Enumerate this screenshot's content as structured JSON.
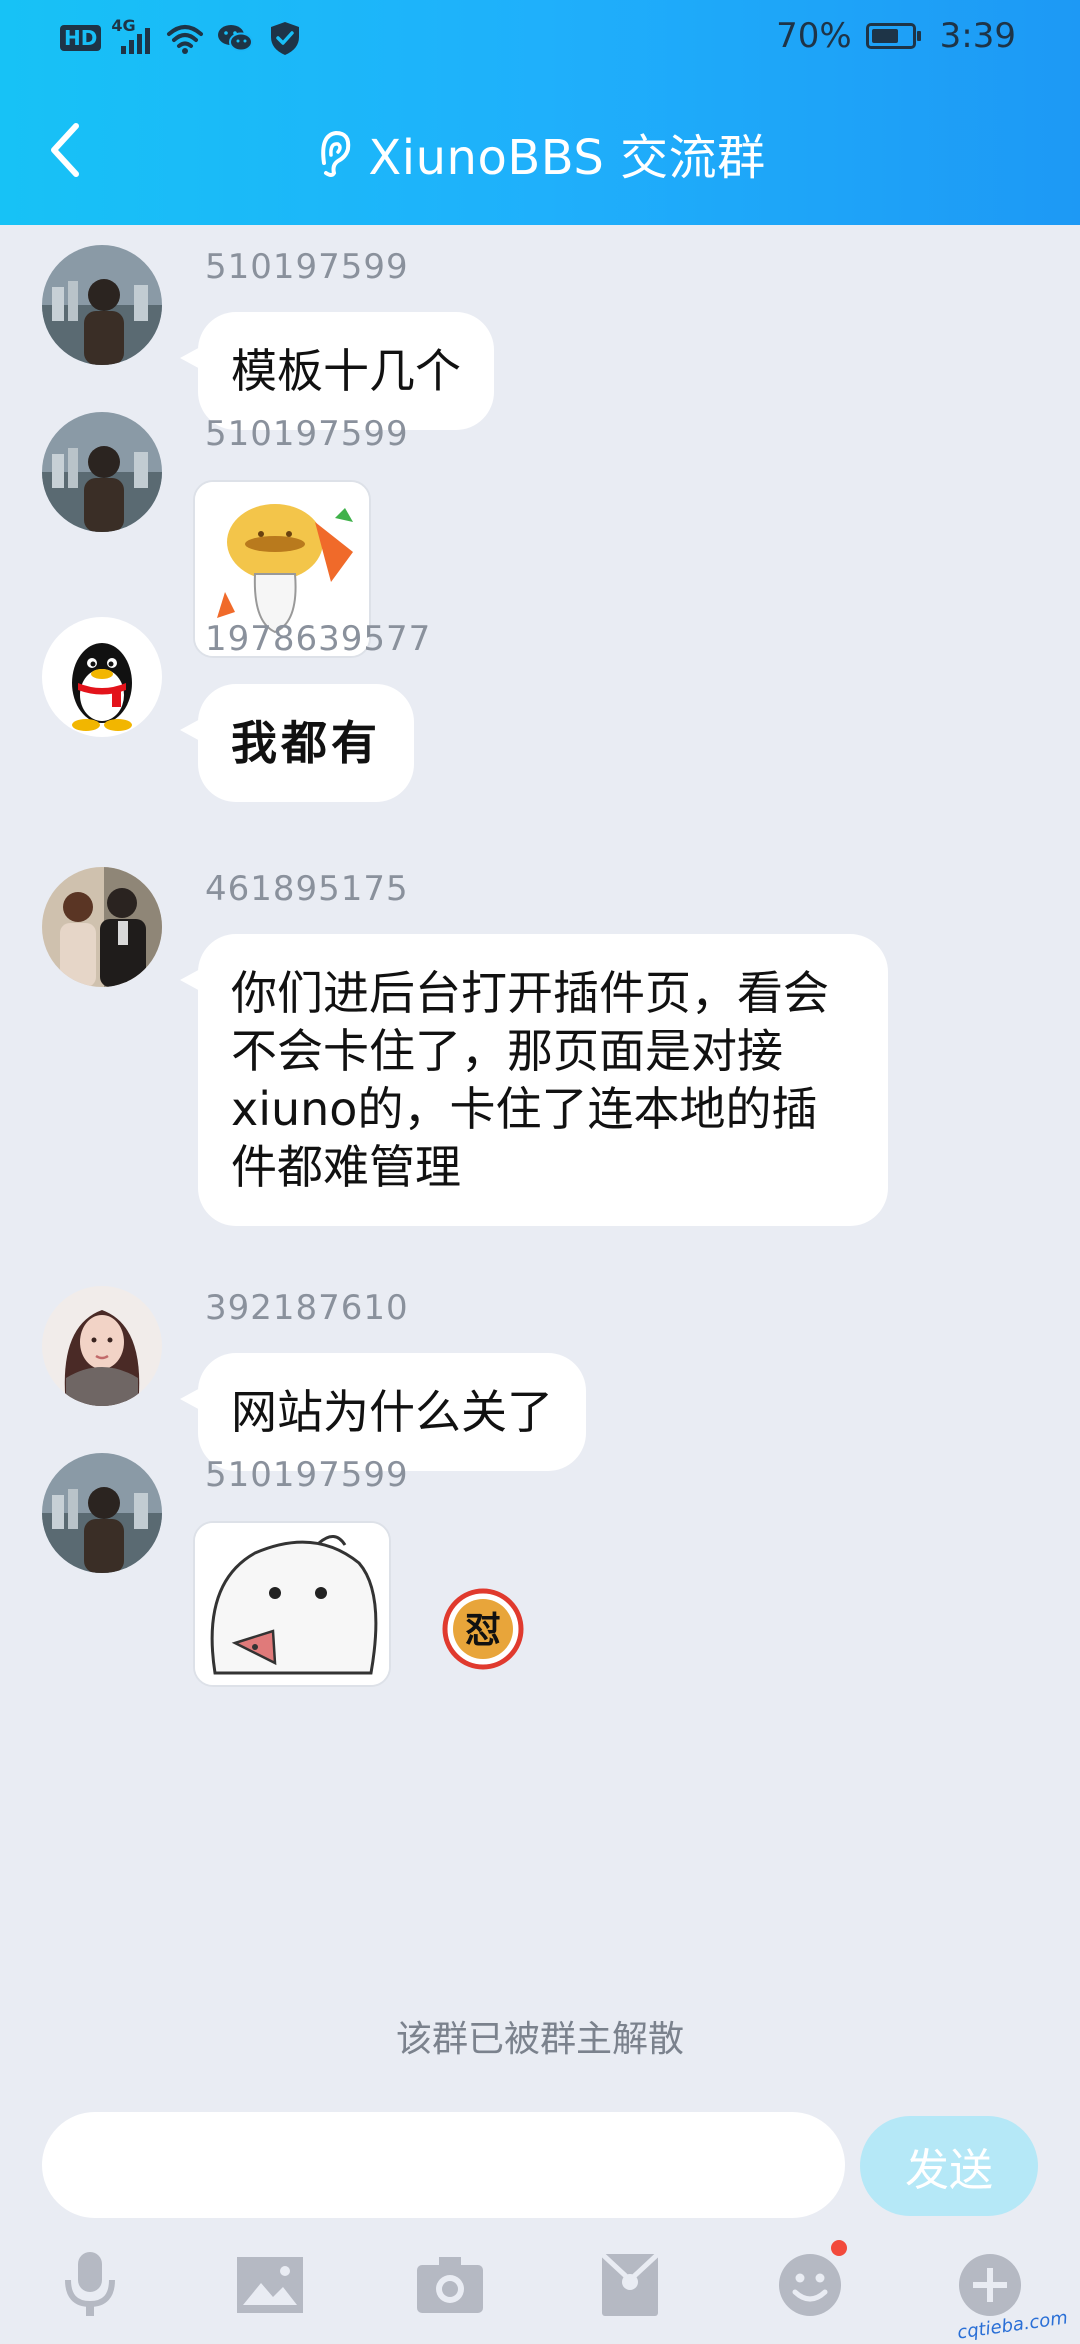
{
  "status_bar": {
    "hd": "HD",
    "network": "4G",
    "battery": "70%",
    "battery_level": 0.7,
    "time": "3:39"
  },
  "header": {
    "title": "XiunoBBS 交流群"
  },
  "messages": [
    {
      "sender": "510197599",
      "type": "text",
      "text": "模板十几个"
    },
    {
      "sender": "510197599",
      "type": "sticker",
      "sticker": "orange-blob-sticker"
    },
    {
      "sender": "1978639577",
      "type": "text",
      "text": "我都有"
    },
    {
      "sender": "461895175",
      "type": "text",
      "text": "你们进后台打开插件页，看会不会卡住了，那页面是对接xiuno的，卡住了连本地的插件都难管理"
    },
    {
      "sender": "392187610",
      "type": "text",
      "text": "网站为什么关了"
    },
    {
      "sender": "510197599",
      "type": "sticker",
      "sticker": "white-blob-sticker",
      "reaction": "怼"
    }
  ],
  "system_note": "该群已被群主解散",
  "input": {
    "placeholder": "",
    "send_label": "发送"
  },
  "toolbar": {
    "items": [
      "mic-icon",
      "image-icon",
      "camera-icon",
      "red-packet-icon",
      "emoji-icon",
      "plus-icon"
    ]
  },
  "watermark": "cqtieba.com",
  "colors": {
    "header_start": "#17c2f6",
    "header_end": "#1d99f5",
    "background": "#e9ecf3",
    "send_button": "#b5e8f7",
    "notify_dot": "#f24a3c"
  }
}
